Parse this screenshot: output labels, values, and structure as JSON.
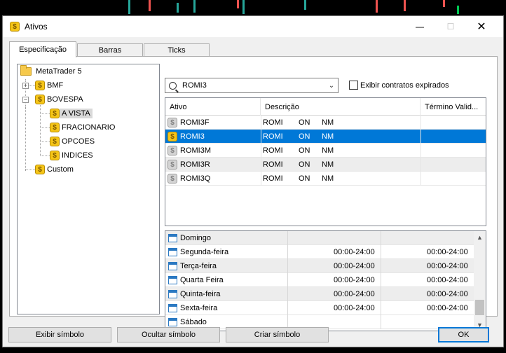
{
  "window": {
    "title": "Ativos",
    "icon": "coin-icon"
  },
  "tabs": [
    {
      "label": "Especificação",
      "active": true
    },
    {
      "label": "Barras",
      "active": false
    },
    {
      "label": "Ticks",
      "active": false
    }
  ],
  "tree": {
    "root": "MetaTrader 5",
    "items": [
      {
        "label": "BMF",
        "expander": "+"
      },
      {
        "label": "BOVESPA",
        "expander": "-"
      },
      {
        "label": "A VISTA",
        "selected": true
      },
      {
        "label": "FRACIONARIO"
      },
      {
        "label": "OPCOES"
      },
      {
        "label": "INDICES"
      },
      {
        "label": "Custom"
      }
    ]
  },
  "search": {
    "value": "ROMI3",
    "expired_label": "Exibir contratos expirados",
    "expired_checked": false
  },
  "symbols": {
    "columns": [
      "Ativo",
      "Descrição",
      "Término Valid..."
    ],
    "rows": [
      {
        "ativo": "ROMI3F",
        "d1": "ROMI",
        "d2": "ON",
        "d3": "NM",
        "selected": false
      },
      {
        "ativo": "ROMI3",
        "d1": "ROMI",
        "d2": "ON",
        "d3": "NM",
        "selected": true
      },
      {
        "ativo": "ROMI3M",
        "d1": "ROMI",
        "d2": "ON",
        "d3": "NM",
        "selected": false
      },
      {
        "ativo": "ROMI3R",
        "d1": "ROMI",
        "d2": "ON",
        "d3": "NM",
        "selected": false
      },
      {
        "ativo": "ROMI3Q",
        "d1": "ROMI",
        "d2": "ON",
        "d3": "NM",
        "selected": false
      }
    ]
  },
  "sessions": {
    "rows": [
      {
        "day": "Domingo",
        "quotes": "",
        "trades": ""
      },
      {
        "day": "Segunda-feira",
        "quotes": "00:00-24:00",
        "trades": "00:00-24:00"
      },
      {
        "day": "Terça-feira",
        "quotes": "00:00-24:00",
        "trades": "00:00-24:00"
      },
      {
        "day": "Quarta Feira",
        "quotes": "00:00-24:00",
        "trades": "00:00-24:00"
      },
      {
        "day": "Quinta-feira",
        "quotes": "00:00-24:00",
        "trades": "00:00-24:00"
      },
      {
        "day": "Sexta-feira",
        "quotes": "00:00-24:00",
        "trades": "00:00-24:00"
      },
      {
        "day": "Sábado",
        "quotes": "",
        "trades": ""
      }
    ]
  },
  "buttons": {
    "show": "Exibir símbolo",
    "hide": "Ocultar símbolo",
    "create": "Criar símbolo",
    "ok": "OK"
  },
  "colors": {
    "selection": "#0078d7",
    "coin": "#f5c518"
  }
}
